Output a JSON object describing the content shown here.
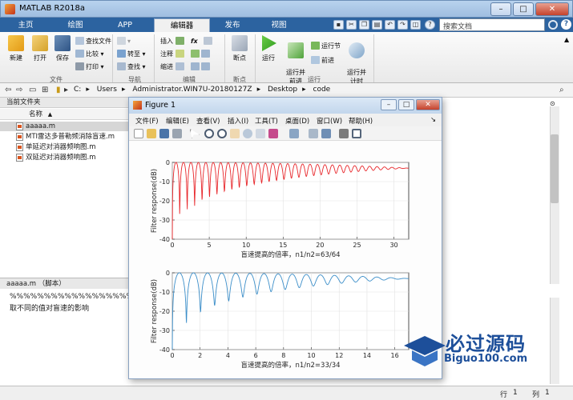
{
  "app": {
    "title": "MATLAB R2018a"
  },
  "window_controls": {
    "minimize": "–",
    "maximize": "□",
    "close": "✕"
  },
  "tabs": [
    "主页",
    "绘图",
    "APP",
    "编辑器",
    "发布",
    "视图"
  ],
  "active_tab": "编辑器",
  "search": {
    "placeholder": "搜索文档"
  },
  "ribbon": {
    "file_group": {
      "label": "文件",
      "new": "新建",
      "open": "打开",
      "save": "保存",
      "find_files": "查找文件",
      "compare": "比较",
      "print": "打印"
    },
    "nav_group": {
      "label": "导航",
      "goto": "转至",
      "find": "查找"
    },
    "edit_group": {
      "label": "编辑",
      "insert": "插入",
      "comment": "注释",
      "indent": "缩进",
      "fx": "fx"
    },
    "breakpoint_group": {
      "label": "断点",
      "breakpoints": "断点"
    },
    "run_group": {
      "label": "运行",
      "run": "运行",
      "run_advance": "运行并\n前进",
      "run_section": "运行节",
      "advance": "前进",
      "run_time": "运行并\n计时"
    }
  },
  "address": {
    "path": [
      "C:",
      "Users",
      "Administrator.WIN7U-20180127Z",
      "Desktop",
      "code"
    ]
  },
  "current_folder": {
    "title": "当前文件夹",
    "column": "名称",
    "sort_indicator": "▲",
    "files": [
      "aaaaa.m",
      "MTI雷达多普勒频消除盲速.m",
      "单延迟对消器频响图.m",
      "双延迟对消器频响图.m"
    ],
    "selected_index": 0
  },
  "details": {
    "title": "aaaaa.m （脚本）"
  },
  "editor": {
    "lines": [
      "%%%%%%%%%%%%%%%%%%%%  n1/",
      "取不同的值对盲速的影响"
    ]
  },
  "figure": {
    "title": "Figure 1",
    "menu": [
      "文件(F)",
      "编辑(E)",
      "查看(V)",
      "插入(I)",
      "工具(T)",
      "桌面(D)",
      "窗口(W)",
      "帮助(H)"
    ]
  },
  "status": {
    "row_label": "行",
    "row": "1",
    "col_label": "列",
    "col": "1"
  },
  "watermark": {
    "main": "必过源码",
    "sub": "Biguo100.com"
  },
  "colors": {
    "top_plot": "#e8262a",
    "bottom_plot": "#3b8ec9",
    "ribbon_tab_bar": "#2c63a0",
    "watermark": "#1d4f9a"
  },
  "chart_data": [
    {
      "type": "line",
      "xlim": [
        0,
        32
      ],
      "ylim": [
        -40,
        0
      ],
      "x_ticks": [
        0,
        5,
        10,
        15,
        20,
        25,
        30
      ],
      "y_ticks": [
        0,
        -10,
        -20,
        -30,
        -40
      ],
      "xlabel": "盲速提高的倍率，n1/n2=63/64",
      "ylabel": "Filter response(dB)",
      "grid": true,
      "series": [
        {
          "color": "#e8262a",
          "formula": "single canceller sum, ratio 63/64"
        }
      ]
    },
    {
      "type": "line",
      "xlim": [
        0,
        17
      ],
      "ylim": [
        -40,
        0
      ],
      "x_ticks": [
        0,
        2,
        4,
        6,
        8,
        10,
        12,
        14,
        16
      ],
      "y_ticks": [
        0,
        -10,
        -20,
        -30,
        -40
      ],
      "xlabel": "盲速提高的倍率，n1/n2=33/34",
      "ylabel": "Filter response(dB)",
      "grid": true,
      "series": [
        {
          "color": "#3b8ec9",
          "formula": "single canceller sum, ratio 33/34"
        }
      ]
    }
  ]
}
